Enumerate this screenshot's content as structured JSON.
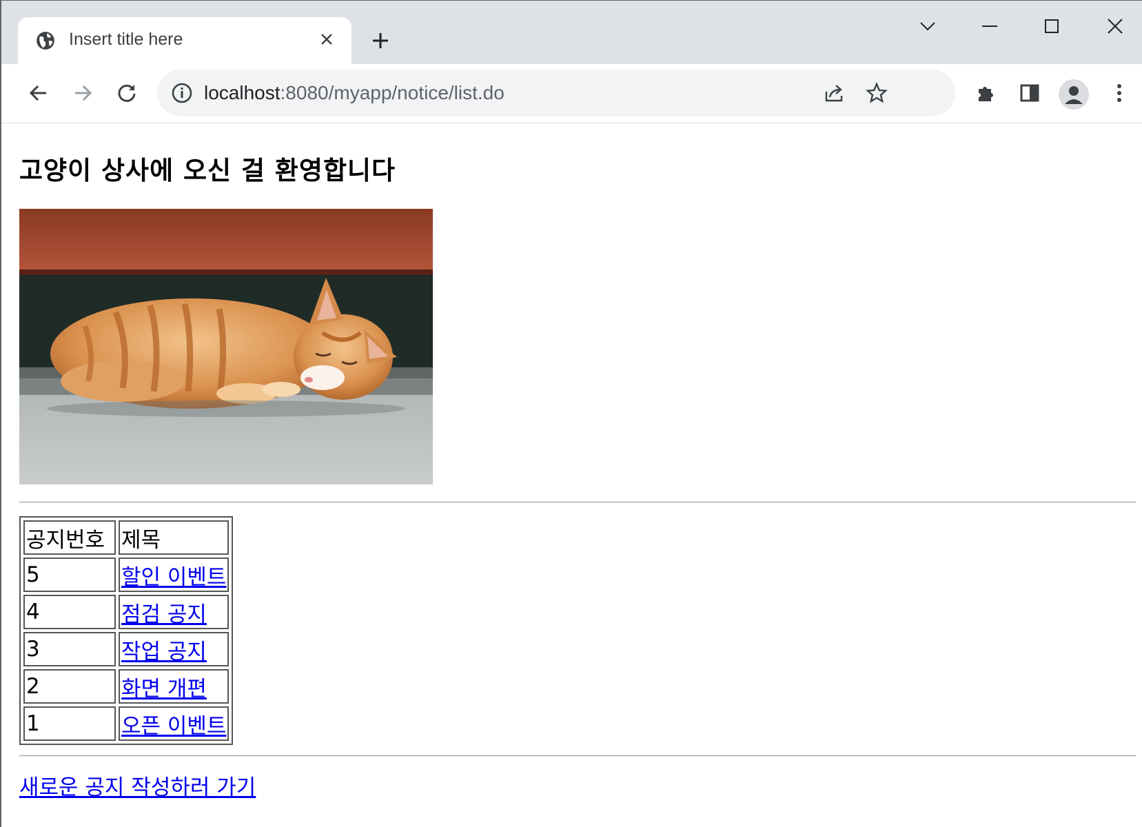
{
  "browser": {
    "tab": {
      "title": "Insert title here",
      "favicon": "globe-icon"
    },
    "omnibox": {
      "url_host": "localhost",
      "url_rest": ":8080/myapp/notice/list.do"
    },
    "icons": [
      "back-arrow-icon",
      "forward-arrow-icon",
      "reload-icon",
      "info-icon",
      "share-icon",
      "star-icon",
      "extensions-icon",
      "side-panel-icon",
      "profile-icon",
      "more-vert-icon",
      "tab-search-icon",
      "minimize-icon",
      "maximize-icon",
      "close-window-icon"
    ]
  },
  "page": {
    "heading": "고양이 상사에 오신 걸 환영합니다",
    "image": "sleeping-orange-kitten",
    "table": {
      "headers": [
        "공지번호",
        "제목"
      ],
      "rows": [
        {
          "num": "5",
          "title": "할인 이벤트"
        },
        {
          "num": "4",
          "title": "점검 공지"
        },
        {
          "num": "3",
          "title": "작업 공지"
        },
        {
          "num": "2",
          "title": "화면 개편"
        },
        {
          "num": "1",
          "title": "오픈 이벤트"
        }
      ]
    },
    "write_link": "새로운 공지 작성하러 가기"
  },
  "colors": {
    "link": "#0000ee",
    "tabstrip": "#dee1e6",
    "omnibox": "#f1f3f4"
  }
}
